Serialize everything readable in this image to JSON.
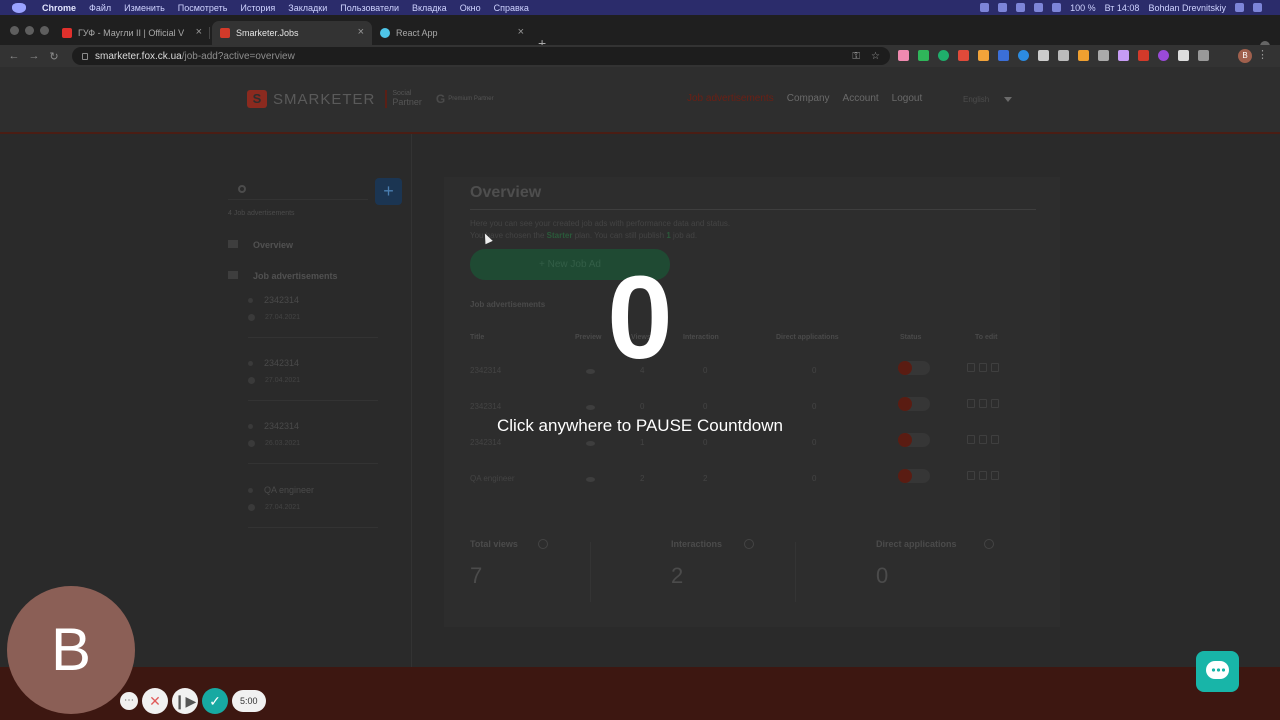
{
  "menubar": {
    "items": [
      "Chrome",
      "Файл",
      "Изменить",
      "Посмотреть",
      "История",
      "Закладки",
      "Пользователи",
      "Вкладка",
      "Окно",
      "Справка"
    ],
    "battery": "100 %",
    "clock": "Вт 14:08",
    "user": "Bohdan Drevnitskiy"
  },
  "tabs": [
    {
      "title": "ГУФ - Маугли II | Official V",
      "favicon_color": "#e0302c"
    },
    {
      "title": "Smarketer.Jobs",
      "favicon_color": "#d23a2a"
    },
    {
      "title": "React App",
      "favicon_color": "#4ec5e8"
    }
  ],
  "address": {
    "host": "smarketer.fox.ck.ua",
    "path": "/job-add?active=overview"
  },
  "profile_initial": "B",
  "site": {
    "logo_text": "SMARKETER",
    "partner_lines": [
      "Social",
      "Partner"
    ],
    "google_lines": [
      "Premium Partner"
    ],
    "nav": [
      {
        "label": "Job advertisements",
        "active": true
      },
      {
        "label": "Company",
        "active": false
      },
      {
        "label": "Account",
        "active": false
      },
      {
        "label": "Logout",
        "active": false
      }
    ],
    "language": "English"
  },
  "sidebar": {
    "count_label": "4 Job advertisements",
    "overview": "Overview",
    "ads_label": "Job advertisements",
    "jobs": [
      {
        "title": "2342314",
        "date": "27.04.2021"
      },
      {
        "title": "2342314",
        "date": "27.04.2021"
      },
      {
        "title": "2342314",
        "date": "26.03.2021"
      },
      {
        "title": "QA engineer",
        "date": "27.04.2021"
      }
    ]
  },
  "main": {
    "title": "Overview",
    "desc_line1": "Here you can see your created job ads with performance data and status.",
    "desc_line2_a": "You have chosen the",
    "plan": "Starter",
    "desc_line2_b": "plan. You can still publish",
    "publish_count": "1",
    "desc_line2_c": "job ad.",
    "new_button": "+ New Job Ad",
    "table_title": "Job advertisements",
    "columns": [
      "Title",
      "Preview",
      "Views",
      "Interaction",
      "Direct applications",
      "Status",
      "To edit"
    ],
    "rows": [
      {
        "title": "2342314",
        "views": "4",
        "interaction": "0",
        "direct": "0"
      },
      {
        "title": "2342314",
        "views": "0",
        "interaction": "0",
        "direct": "0"
      },
      {
        "title": "2342314",
        "views": "1",
        "interaction": "0",
        "direct": "0"
      },
      {
        "title": "QA engineer",
        "views": "2",
        "interaction": "2",
        "direct": "0"
      }
    ],
    "stats": [
      {
        "label": "Total views",
        "value": "7"
      },
      {
        "label": "Interactions",
        "value": "2"
      },
      {
        "label": "Direct applications",
        "value": "0"
      }
    ]
  },
  "overlay": {
    "countdown": "0",
    "message": "Click anywhere to PAUSE Countdown",
    "webcam_initial": "B",
    "timer": "5:00",
    "more_glyph": "⋯",
    "cancel_glyph": "✕",
    "restart_glyph": "❙▶",
    "done_glyph": "✓"
  },
  "colors": {
    "accent_red": "#c8321f",
    "accent_green": "#1e9c5c",
    "chat_teal": "#18b5a8"
  }
}
